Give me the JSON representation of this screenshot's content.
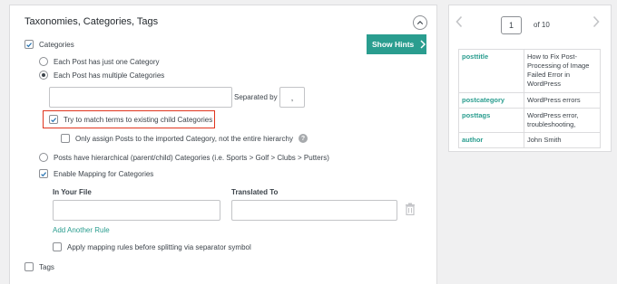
{
  "panel": {
    "title": "Taxonomies, Categories, Tags"
  },
  "show_hints": {
    "label": "Show Hints"
  },
  "categories": {
    "label": "Categories",
    "checked": true,
    "radio_one": "Each Post has just one Category",
    "radio_multiple": "Each Post has multiple Categories",
    "radio_multiple_selected": true,
    "separator_label": "Separated by",
    "separator_value": ",",
    "match_child": "Try to match terms to existing child Categories",
    "match_child_checked": true,
    "only_assign": "Only assign Posts to the imported Category, not the entire hierarchy",
    "help_icon_glyph": "?",
    "hierarchical": "Posts have hierarchical (parent/child) Categories (i.e. Sports > Golf > Clubs > Putters)",
    "enable_mapping": "Enable Mapping for Categories",
    "enable_mapping_checked": true,
    "col_in_file": "In Your File",
    "col_translated": "Translated To",
    "add_rule": "Add Another Rule",
    "apply_before": "Apply mapping rules before splitting via separator symbol"
  },
  "tags": {
    "label": "Tags",
    "checked": false
  },
  "preview": {
    "page": "1",
    "of_text": "of 10",
    "rows": [
      {
        "key": "posttitle",
        "value": "How to Fix Post-Processing of Image Failed Error in WordPress"
      },
      {
        "key": "postcategory",
        "value": "WordPress errors"
      },
      {
        "key": "posttags",
        "value": "WordPress error, troubleshooting,"
      },
      {
        "key": "author",
        "value": "John Smith"
      }
    ]
  },
  "colors": {
    "accent": "#2a9d8f",
    "title": "#23282d",
    "highlight": "#e0341d"
  }
}
